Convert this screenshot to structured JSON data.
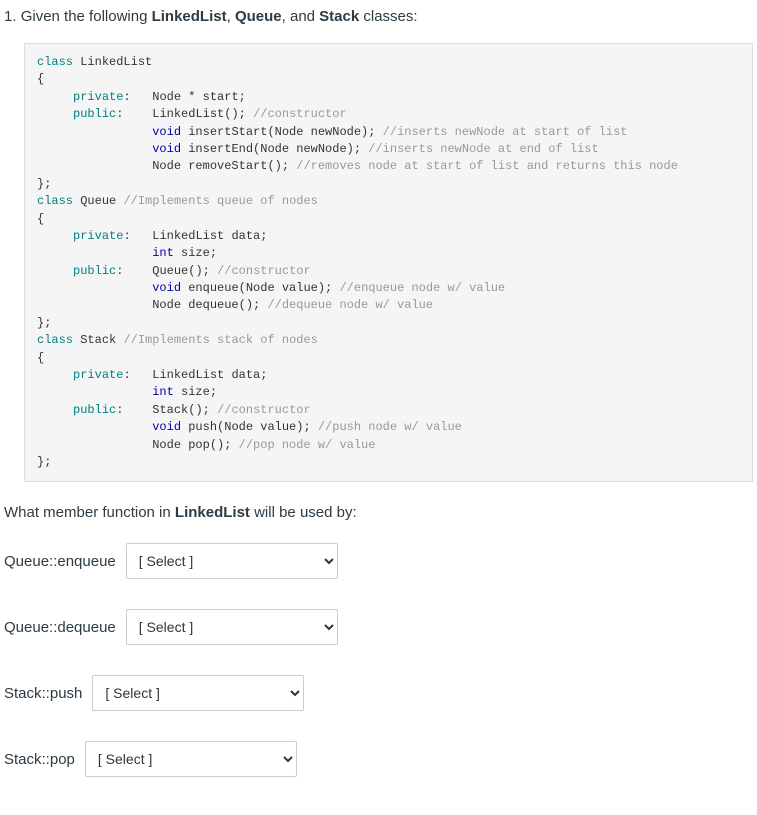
{
  "question": {
    "number": "1.",
    "intro_prefix": "Given the following ",
    "intro_bold1": "LinkedList",
    "intro_sep1": ", ",
    "intro_bold2": "Queue",
    "intro_sep2": ", and ",
    "intro_bold3": "Stack",
    "intro_suffix": " classes:"
  },
  "code": {
    "l01a": "class",
    "l01b": " LinkedList",
    "l02": "{",
    "l03a": "     ",
    "l03b": "private",
    "l03c": ":   Node * start;",
    "l04a": "     ",
    "l04b": "public",
    "l04c": ":    LinkedList(); ",
    "l04d": "//constructor",
    "l05a": "                void",
    "l05b": " insertStart(Node newNode); ",
    "l05c": "//inserts newNode at start of list",
    "l06a": "                void",
    "l06b": " insertEnd(Node newNode); ",
    "l06c": "//inserts newNode at end of list",
    "l07a": "                Node removeStart(); ",
    "l07b": "//removes node at start of list and returns this node",
    "l08": "};",
    "l09a": "class",
    "l09b": " Queue ",
    "l09c": "//Implements queue of nodes",
    "l10": "{",
    "l11a": "     ",
    "l11b": "private",
    "l11c": ":   LinkedList data;",
    "l12a": "                ",
    "l12b": "int",
    "l12c": " size;",
    "l13a": "     ",
    "l13b": "public",
    "l13c": ":    Queue(); ",
    "l13d": "//constructor",
    "l14a": "                void",
    "l14b": " enqueue(Node value); ",
    "l14c": "//enqueue node w/ value",
    "l15a": "                Node dequeue(); ",
    "l15b": "//dequeue node w/ value",
    "l16": "};",
    "l17a": "class",
    "l17b": " Stack ",
    "l17c": "//Implements stack of nodes",
    "l18": "{",
    "l19a": "     ",
    "l19b": "private",
    "l19c": ":   LinkedList data;",
    "l20a": "                ",
    "l20b": "int",
    "l20c": " size;",
    "l21a": "     ",
    "l21b": "public",
    "l21c": ":    Stack(); ",
    "l21d": "//constructor",
    "l22a": "                void",
    "l22b": " push(Node value); ",
    "l22c": "//push node w/ value",
    "l23a": "                Node pop(); ",
    "l23b": "//pop node w/ value",
    "l24": "};"
  },
  "subq": {
    "prefix": "What member function in ",
    "bold": "LinkedList",
    "suffix": " will be used by:"
  },
  "rows": [
    {
      "label": "Queue::enqueue",
      "selected": "[ Select ]"
    },
    {
      "label": "Queue::dequeue",
      "selected": "[ Select ]"
    },
    {
      "label": "Stack::push",
      "selected": "[ Select ]"
    },
    {
      "label": "Stack::pop",
      "selected": "[ Select ]"
    }
  ]
}
